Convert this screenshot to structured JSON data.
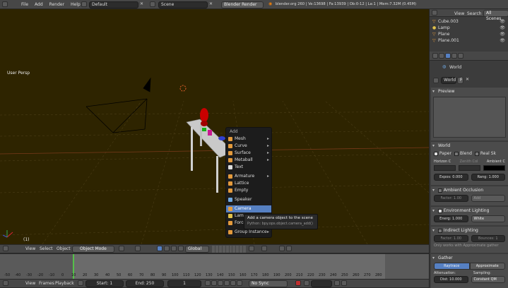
{
  "topbar": {
    "menus": [
      "File",
      "Add",
      "Render",
      "Help"
    ],
    "layout": "Default",
    "scene": "Scene",
    "engine": "Blender Render",
    "stats": "blender.org 260 | Ve:13698 | Fa:13939 | Ob:0-12 | La:1 | Mem:7.32M (0.45M)"
  },
  "viewport": {
    "label": "User Persp",
    "frame_label": "(1)",
    "bg_color": "#2e2400"
  },
  "add_menu": {
    "title": "Add",
    "items": [
      {
        "label": "Mesh",
        "submenu": true,
        "color": "#e39a3c"
      },
      {
        "label": "Curve",
        "submenu": true,
        "color": "#e39a3c"
      },
      {
        "label": "Surface",
        "submenu": true,
        "color": "#e39a3c"
      },
      {
        "label": "Metaball",
        "submenu": true,
        "color": "#e39a3c"
      },
      {
        "label": "Text",
        "submenu": false,
        "color": "#dddddd"
      },
      {
        "label": "Armature",
        "submenu": true,
        "color": "#e39a3c"
      },
      {
        "label": "Lattice",
        "submenu": false,
        "color": "#e39a3c"
      },
      {
        "label": "Empty",
        "submenu": false,
        "color": "#e39a3c"
      },
      {
        "label": "Speaker",
        "submenu": false,
        "color": "#6fa7e0"
      },
      {
        "label": "Camera",
        "submenu": false,
        "color": "#e39a3c",
        "active": true
      },
      {
        "label": "Lamp",
        "submenu": true,
        "color": "#e0c04a"
      },
      {
        "label": "Force",
        "submenu": true,
        "color": "#e39a3c"
      },
      {
        "label": "Group Instance",
        "submenu": true,
        "color": "#e39a3c"
      }
    ],
    "tooltip_title": "Add a camera object to the scene",
    "tooltip_python": "Python: bpy.ops.object.camera_add()"
  },
  "viewport_header": {
    "menus": [
      "View",
      "Select",
      "Object"
    ],
    "mode": "Object Mode",
    "orientation": "Global"
  },
  "timeline": {
    "ticks": [
      "-50",
      "-40",
      "-30",
      "-20",
      "-10",
      "0",
      "10",
      "20",
      "30",
      "40",
      "50",
      "60",
      "70",
      "80",
      "90",
      "100",
      "110",
      "120",
      "130",
      "140",
      "150",
      "160",
      "170",
      "180",
      "190",
      "200",
      "210",
      "220",
      "230",
      "240",
      "250",
      "260",
      "270",
      "280"
    ],
    "menus": [
      "View",
      "Frames",
      "Playback"
    ],
    "start": "Start: 1",
    "end": "End: 250",
    "current": "1",
    "sync": "No Sync"
  },
  "outliner": {
    "tabs": [
      "View",
      "Search",
      "All Scenes"
    ],
    "items": [
      "Cube.003",
      "Lamp",
      "Plane",
      "Plane.001"
    ]
  },
  "properties": {
    "breadcrumb": "World",
    "world_name": "World",
    "world_users": "F",
    "preview_label": "Preview",
    "world_panel": "World",
    "checks": [
      "Paper",
      "Blend",
      "Real Sk"
    ],
    "color_labels": [
      "Horizon C",
      "Zenith Col",
      "Ambient C"
    ],
    "exposure": "Expos: 0.000",
    "range": "Rang: 1.000",
    "ambient_occlusion": "Ambient Occlusion",
    "ao_factor": "Factor: 1.00",
    "ao_mode": "Add",
    "env_lighting": "Environment Lighting",
    "env_energy": "Energ: 1.000",
    "env_color": "White",
    "indirect_lighting": "Indirect Lighting",
    "ind_factor": "Factor: 1.00",
    "ind_bounces": "Bounces: 1",
    "approx_note": "Only works with Approximate gather",
    "gather": "Gather",
    "raytrace": "Raytrace",
    "approximate": "Approximate",
    "attenuation": "Attenuation:",
    "sampling": "Sampling:",
    "distance": "Dist: 10.000",
    "sampling_method": "Constant QM"
  }
}
